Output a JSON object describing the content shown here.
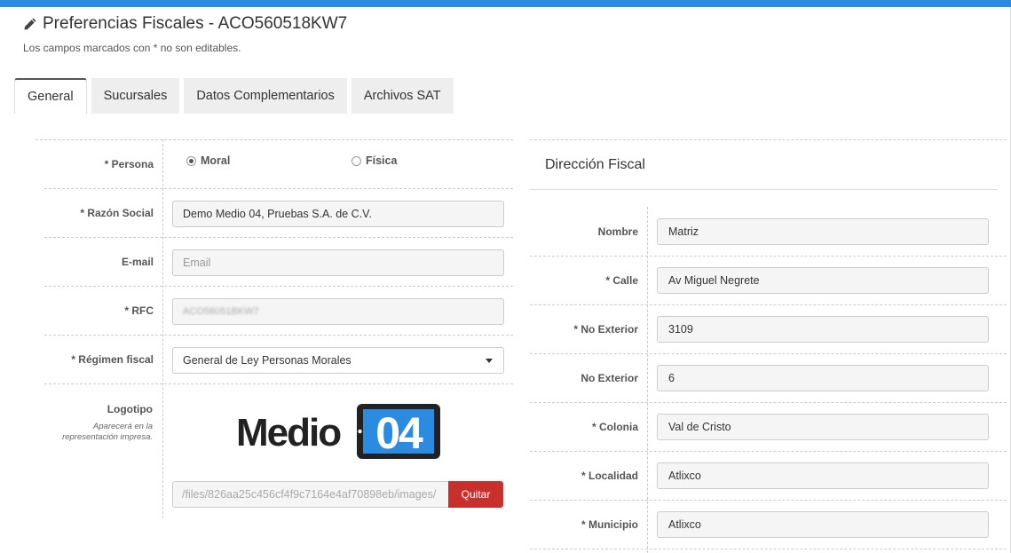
{
  "header": {
    "title": "Preferencias Fiscales - ACO560518KW7",
    "subtitle": "Los campos marcados con * no son editables."
  },
  "tabs": [
    {
      "label": "General",
      "active": true
    },
    {
      "label": "Sucursales",
      "active": false
    },
    {
      "label": "Datos Complementarios",
      "active": false
    },
    {
      "label": "Archivos SAT",
      "active": false
    }
  ],
  "general": {
    "persona": {
      "label": "* Persona",
      "options": [
        {
          "label": "Moral",
          "selected": true
        },
        {
          "label": "Física",
          "selected": false
        }
      ]
    },
    "razon_social": {
      "label": "* Razón Social",
      "value": "Demo Medio 04, Pruebas S.A. de C.V."
    },
    "email": {
      "label": "E-mail",
      "value": "",
      "placeholder": "Email"
    },
    "rfc": {
      "label": "* RFC",
      "value": "ACO56051BKW7"
    },
    "regimen_fiscal": {
      "label": "* Régimen fiscal",
      "value": "General de Ley Personas Morales"
    },
    "logotipo": {
      "label": "Logotipo",
      "help": "Aparecerá en la representación impresa.",
      "logo_text": {
        "left": "Medio",
        "right": "04"
      },
      "file_path": "/files/826aa25c456cf4f9c7164e4af70898eb/images/",
      "remove_label": "Quitar"
    }
  },
  "direccion_fiscal": {
    "title": "Dirección Fiscal",
    "fields": [
      {
        "label": "Nombre",
        "value": "Matriz"
      },
      {
        "label": "* Calle",
        "value": "Av Miguel Negrete"
      },
      {
        "label": "* No Exterior",
        "value": "3109"
      },
      {
        "label": "No Exterior",
        "value": "6"
      },
      {
        "label": "* Colonia",
        "value": "Val de Cristo"
      },
      {
        "label": "* Localidad",
        "value": "Atlixco"
      },
      {
        "label": "* Municipio",
        "value": "Atlixco"
      }
    ]
  },
  "colors": {
    "topbar": "#2a8be0",
    "danger": "#c9302c",
    "logo_blue": "#2a8be0",
    "logo_dark": "#222222"
  },
  "icons": {
    "title_icon": "pencil-icon",
    "select_icon": "caret-down-icon"
  }
}
